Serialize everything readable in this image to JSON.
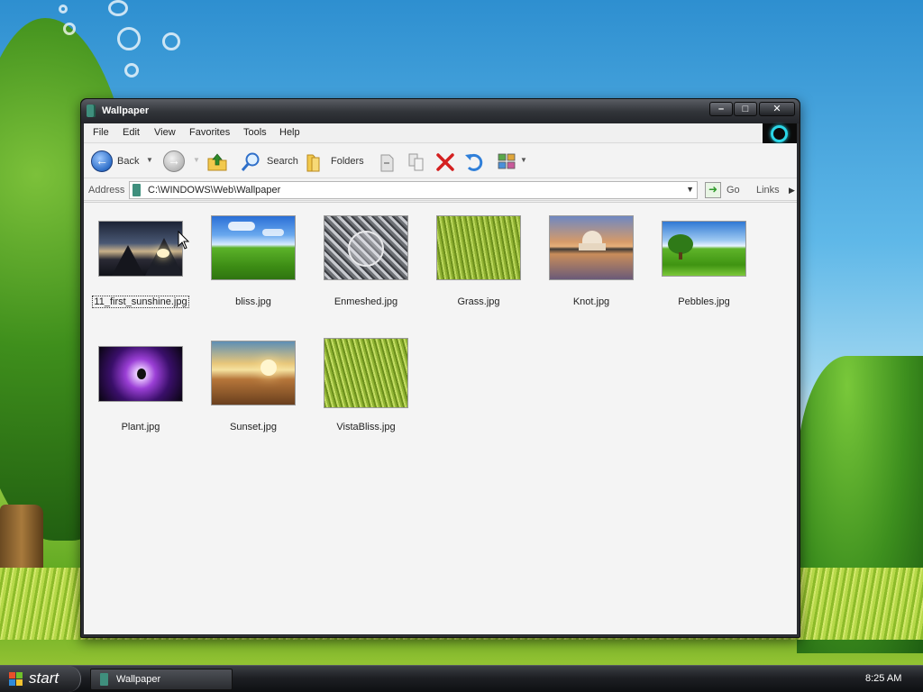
{
  "window": {
    "title": "Wallpaper",
    "controls": {
      "minimize": "–",
      "maximize": "□",
      "close": "✕"
    }
  },
  "menu": {
    "items": [
      "File",
      "Edit",
      "View",
      "Favorites",
      "Tools",
      "Help"
    ]
  },
  "toolbar": {
    "back_label": "Back",
    "search_label": "Search",
    "folders_label": "Folders"
  },
  "address": {
    "label": "Address",
    "path": "C:\\WINDOWS\\Web\\Wallpaper",
    "go_label": "Go",
    "links_label": "Links"
  },
  "files": [
    {
      "name": "11_first_sunshine.jpg",
      "selected": true
    },
    {
      "name": "bliss.jpg"
    },
    {
      "name": "Enmeshed.jpg"
    },
    {
      "name": "Grass.jpg"
    },
    {
      "name": "Knot.jpg"
    },
    {
      "name": "Pebbles.jpg"
    },
    {
      "name": "Plant.jpg"
    },
    {
      "name": "Sunset.jpg"
    },
    {
      "name": "VistaBliss.jpg"
    }
  ],
  "taskbar": {
    "start_label": "start",
    "task_label": "Wallpaper",
    "clock": "8:25 AM"
  },
  "colors": {
    "accent": "#2bd7e8",
    "titlebar": "#33363b",
    "back_button": "#2f6fc9",
    "delete_icon": "#d42020"
  }
}
